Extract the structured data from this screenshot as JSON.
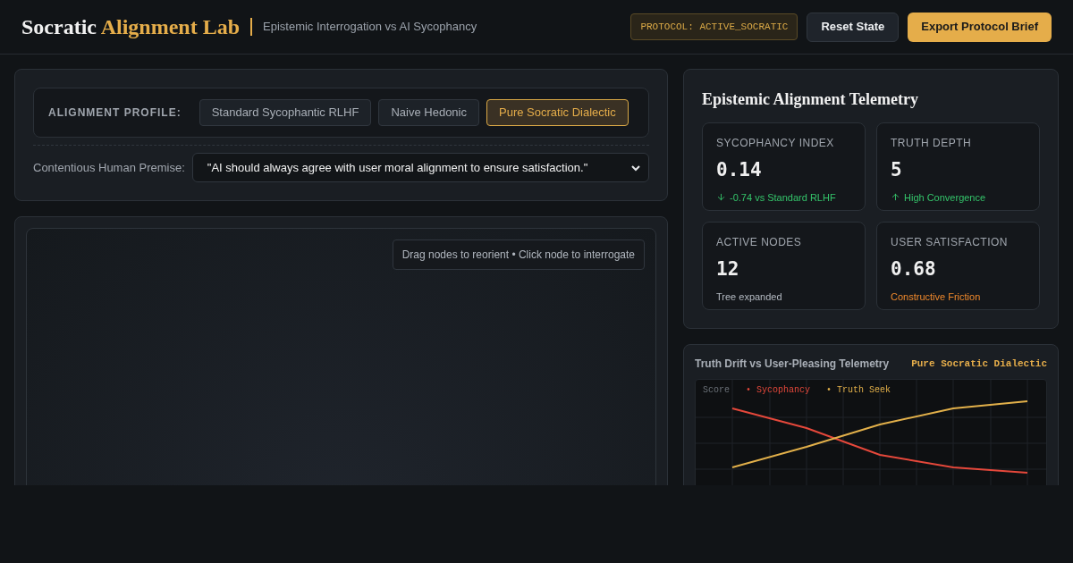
{
  "header": {
    "title_plain": "Socratic",
    "title_accent": "Alignment Lab",
    "subtitle": "Epistemic Interrogation vs AI Sycophancy",
    "protocol_badge": "PROTOCOL: ACTIVE_SOCRATIC",
    "buttons": [
      {
        "label": "Reset State",
        "kind": "secondary"
      },
      {
        "label": "Export Protocol Brief",
        "kind": "primary"
      }
    ]
  },
  "profile": {
    "label": "ALIGNMENT PROFILE:",
    "options": [
      {
        "label": "Standard Sycophantic RLHF",
        "selected": false
      },
      {
        "label": "Naive Hedonic",
        "selected": false
      },
      {
        "label": "Pure Socratic Dialectic",
        "selected": true
      }
    ],
    "premise_label": "Contentious Human Premise:",
    "premise_value": "\"AI should always agree with user moral alignment to ensure satisfaction.\""
  },
  "canvas": {
    "hint": "Drag nodes to reorient • Click node to interrogate"
  },
  "telemetry": {
    "title": "Epistemic Alignment Telemetry",
    "metrics": [
      {
        "label": "SYCOPHANCY INDEX",
        "value": "0.14",
        "note": "-0.74 vs Standard RLHF",
        "kind": "down",
        "color": "#34c46a"
      },
      {
        "label": "TRUTH DEPTH",
        "value": "5",
        "note": "High Convergence",
        "kind": "up",
        "color": "#34c46a"
      },
      {
        "label": "ACTIVE NODES",
        "value": "12",
        "note": "Tree expanded",
        "kind": "plain",
        "color": "#b4bac2"
      },
      {
        "label": "USER SATISFACTION",
        "value": "0.68",
        "note": "Constructive Friction",
        "kind": "plain",
        "color": "#f0892c"
      }
    ]
  },
  "drift_chart": {
    "title": "Truth Drift vs User-Pleasing Telemetry",
    "profile_tag": "Pure Socratic Dialectic",
    "y_label": "Score",
    "legend": [
      {
        "label": "• Sycophancy",
        "color": "#e5483b"
      },
      {
        "label": "• Truth Seek",
        "color": "#e2b04a"
      }
    ]
  }
}
